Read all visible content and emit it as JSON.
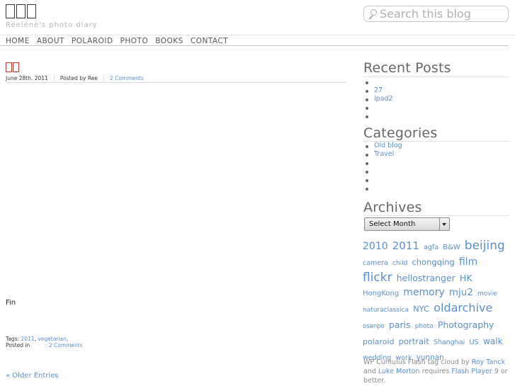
{
  "header": {
    "site_title_glyph_count": 3,
    "tagline": "Reelene's photo diary",
    "search_placeholder": "Search this blog"
  },
  "nav": [
    "HOME",
    "ABOUT",
    "POLAROID",
    "PHOTO",
    "BOOKS",
    "CONTACT"
  ],
  "post": {
    "title_glyph_count": 2,
    "date": "June 28th. 2011",
    "author": "Posted by Ree",
    "comments": "2 Comments",
    "body": "Fin",
    "tags_label": "Tags:",
    "tags": [
      "2011",
      "vegetarian"
    ],
    "posted_in_label": "Posted in",
    "footer_comments": "2 Comments"
  },
  "older_entries": "« Older Entries",
  "sidebar": {
    "recent_posts_title": "Recent Posts",
    "recent_posts": [
      "",
      "27",
      "ipad2",
      "",
      ""
    ],
    "categories_title": "Categories",
    "categories": [
      "Old blog",
      "Travel",
      "",
      "",
      "",
      ""
    ],
    "archives_title": "Archives",
    "archives_select": "Select Month",
    "tag_cloud": [
      {
        "t": "2010",
        "s": 14
      },
      {
        "t": "2011",
        "s": 15
      },
      {
        "t": "agfa",
        "s": 9.5
      },
      {
        "t": "B&W",
        "s": 10
      },
      {
        "t": "beijing",
        "s": 17
      },
      {
        "t": "camera",
        "s": 9.5
      },
      {
        "t": "child",
        "s": 9
      },
      {
        "t": "chongqing",
        "s": 11.5
      },
      {
        "t": "film",
        "s": 14
      },
      {
        "t": "flickr",
        "s": 17
      },
      {
        "t": "hellostranger",
        "s": 12.5
      },
      {
        "t": "HK",
        "s": 12.5
      },
      {
        "t": "HongKong",
        "s": 10
      },
      {
        "t": "memory",
        "s": 14
      },
      {
        "t": "mju2",
        "s": 13.5
      },
      {
        "t": "movie",
        "s": 9
      },
      {
        "t": "naturaclassica",
        "s": 9
      },
      {
        "t": "NYC",
        "s": 11.5
      },
      {
        "t": "oldarchive",
        "s": 16
      },
      {
        "t": "osanpo",
        "s": 8.5
      },
      {
        "t": "paris",
        "s": 12.5
      },
      {
        "t": "photo",
        "s": 9
      },
      {
        "t": "Photography",
        "s": 12.5
      },
      {
        "t": "polaroid",
        "s": 11
      },
      {
        "t": "portrait",
        "s": 11.5
      },
      {
        "t": "Shanghai",
        "s": 9.5
      },
      {
        "t": "US",
        "s": 10
      },
      {
        "t": "walk",
        "s": 12
      },
      {
        "t": "wedding",
        "s": 9.5
      },
      {
        "t": "work",
        "s": 9.5
      },
      {
        "t": "yunnan",
        "s": 10.5
      }
    ],
    "credit": {
      "p1": "WP Cumulus Flash tag cloud by ",
      "a1": "Roy Tanck",
      "p2": " and ",
      "a2": "Luke Morton",
      "p3": " requires ",
      "a3": "Flash Player",
      "p4": " 9 or better."
    }
  }
}
